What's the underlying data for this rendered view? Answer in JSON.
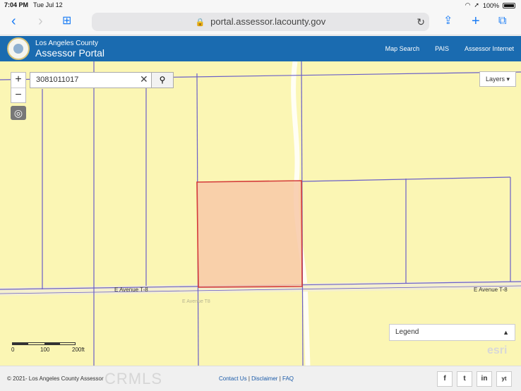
{
  "status_bar": {
    "time": "7:04 PM",
    "date": "Tue Jul 12",
    "battery": "100%"
  },
  "browser": {
    "url": "portal.assessor.lacounty.gov"
  },
  "header": {
    "org": "Los Angeles County",
    "title": "Assessor Portal",
    "links": [
      "Map Search",
      "PAIS",
      "Assessor Internet"
    ]
  },
  "map": {
    "search_value": "3081011017",
    "layers_label": "Layers ▾",
    "legend_label": "Legend",
    "road_label_left": "E Avenue T-8",
    "road_label_right": "E Avenue T-8",
    "road_label_faint": "E Avenue T8",
    "scale_labels": [
      "0",
      "100",
      "200ft"
    ],
    "logo_text": "esri",
    "colors": {
      "background": "#fbf6b4",
      "parcel_line": "#6a5fc8",
      "selected_fill": "#f8c9a8",
      "selected_stroke": "#d43a3a"
    }
  },
  "footer": {
    "copyright": "© 2021- Los Angeles County Assessor",
    "watermark": "CRMLS",
    "links": [
      "Contact Us",
      "Disclaimer",
      "FAQ"
    ],
    "social": [
      "f",
      "t",
      "in",
      "yt"
    ]
  }
}
